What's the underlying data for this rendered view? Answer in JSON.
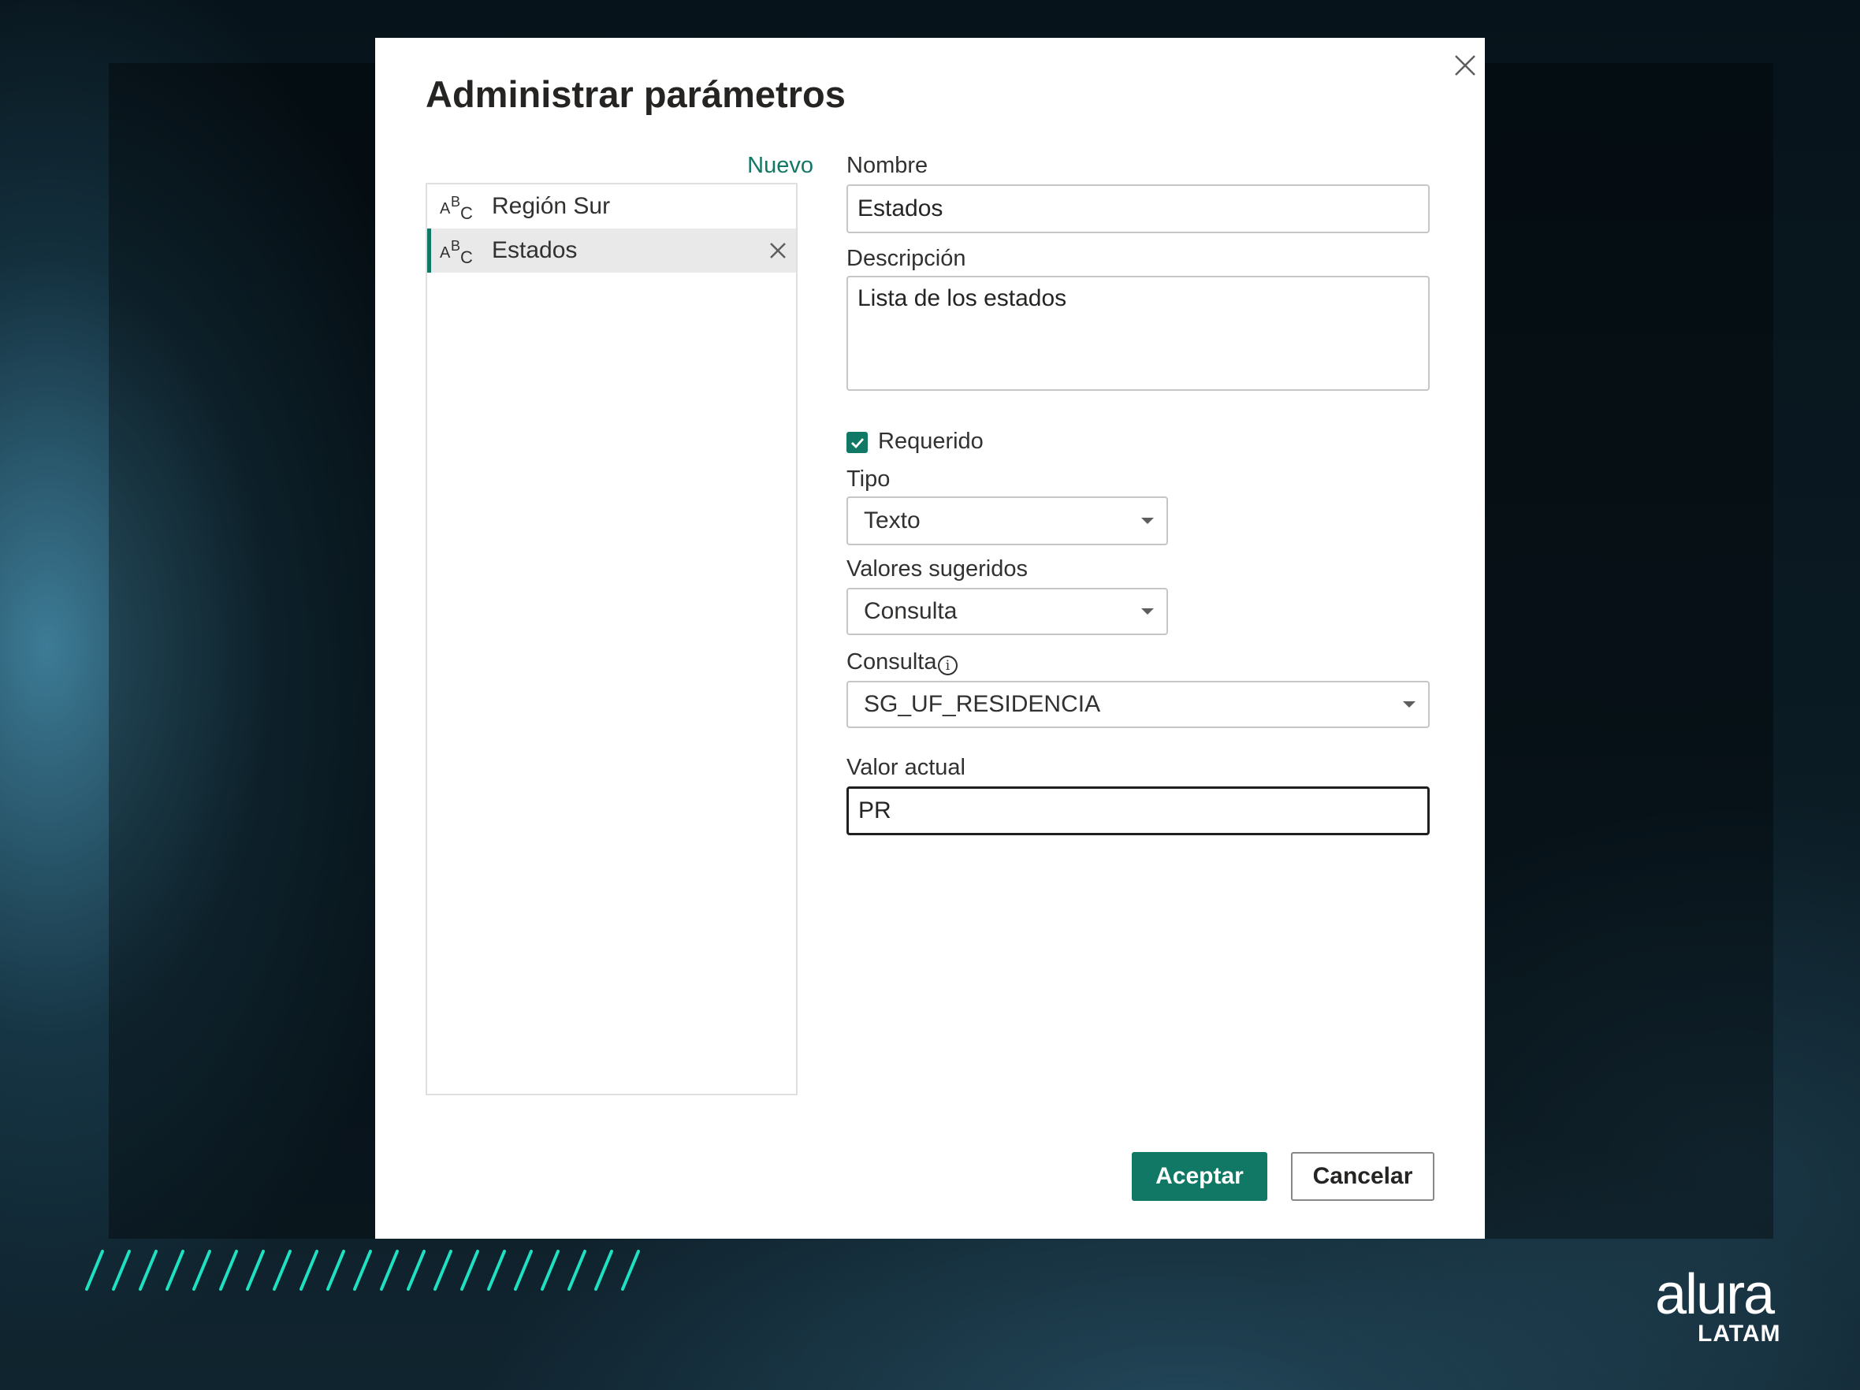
{
  "dialog": {
    "title": "Administrar parámetros",
    "new_link": "Nuevo",
    "parameters": [
      {
        "label": "Región Sur",
        "selected": false
      },
      {
        "label": "Estados",
        "selected": true
      }
    ],
    "fields": {
      "name_label": "Nombre",
      "name_value": "Estados",
      "description_label": "Descripción",
      "description_value": "Lista de los estados",
      "required_label": "Requerido",
      "required_checked": true,
      "type_label": "Tipo",
      "type_value": "Texto",
      "suggested_label": "Valores sugeridos",
      "suggested_value": "Consulta",
      "query_label": "Consulta",
      "query_value": "SG_UF_RESIDENCIA",
      "current_label": "Valor actual",
      "current_value": "PR"
    },
    "buttons": {
      "accept": "Aceptar",
      "cancel": "Cancelar"
    }
  },
  "branding": {
    "logo_word": "alura",
    "logo_sub": "LATAM"
  },
  "colors": {
    "accent": "#117865",
    "decor": "#1fe0c0",
    "background": "#0b1c25"
  }
}
